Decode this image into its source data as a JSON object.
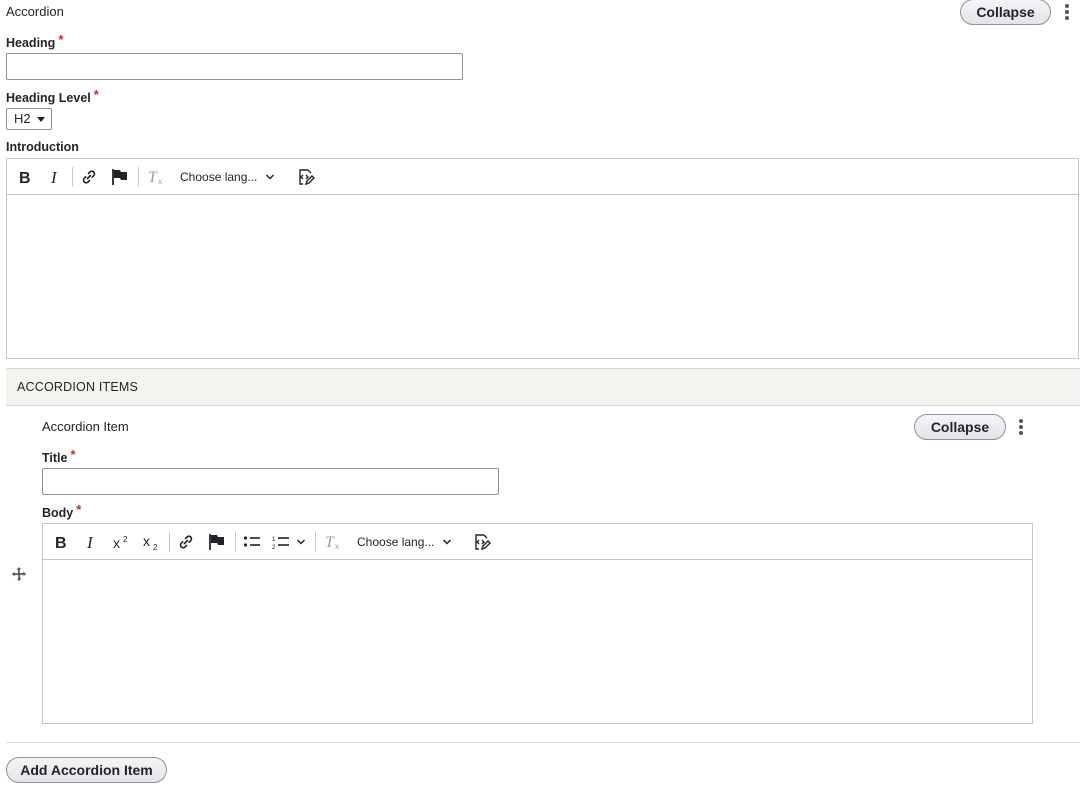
{
  "paragraph": {
    "title": "Accordion",
    "collapse_label": "Collapse"
  },
  "fields": {
    "heading": {
      "label": "Heading",
      "required": "*",
      "value": ""
    },
    "heading_level": {
      "label": "Heading Level",
      "required": "*",
      "selected": "H2"
    },
    "introduction": {
      "label": "Introduction"
    }
  },
  "editor_toolbar": {
    "language_label": "Choose lang..."
  },
  "accordion_items": {
    "section_title": "ACCORDION ITEMS",
    "item": {
      "title": "Accordion Item",
      "collapse_label": "Collapse",
      "title_field": {
        "label": "Title",
        "required": "*",
        "value": ""
      },
      "body_field": {
        "label": "Body",
        "required": "*"
      }
    },
    "add_button_label": "Add Accordion Item"
  },
  "icons": [
    "bold-icon",
    "italic-icon",
    "link-icon",
    "flag-icon",
    "remove-format-icon",
    "chevron-down-icon",
    "source-edit-icon",
    "superscript-icon",
    "subscript-icon",
    "bulleted-list-icon",
    "numbered-list-icon",
    "drag-handle-icon",
    "kebab-menu-icon"
  ],
  "colors": {
    "required": "#d72222",
    "section_bg": "#f3f4ef",
    "border": "#8e929c"
  }
}
